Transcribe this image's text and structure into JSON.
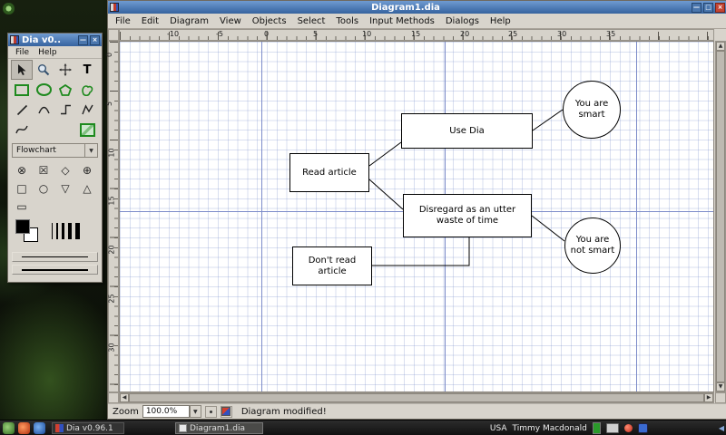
{
  "icons": {
    "close": "×",
    "minimize": "—",
    "maximize": "□",
    "dropdown": "▼",
    "arrow_left": "◀",
    "arrow_right": "▶",
    "arrow_up": "▲",
    "arrow_down": "▼",
    "panel_hide": "◀"
  },
  "main_window": {
    "title": "Diagram1.dia",
    "menus": [
      "File",
      "Edit",
      "Diagram",
      "View",
      "Objects",
      "Select",
      "Tools",
      "Input Methods",
      "Dialogs",
      "Help"
    ],
    "ruler_h_labels": [
      "-10",
      "-5",
      "0",
      "5",
      "10",
      "15",
      "20",
      "25",
      "30",
      "35"
    ],
    "ruler_v_labels": [
      "0",
      "5",
      "10",
      "15",
      "20",
      "25",
      "30"
    ],
    "statusbar": {
      "zoom_label": "Zoom",
      "zoom_value": "100.0%",
      "message": "Diagram modified!"
    }
  },
  "diagram": {
    "nodes": {
      "use_dia": "Use Dia",
      "read_article": "Read article",
      "disregard": "Disregard as an utter waste of time",
      "dont_read": "Don't read article",
      "smart": "You are smart",
      "not_smart": "You are not smart"
    }
  },
  "toolbox": {
    "title": "Dia v0..",
    "menus": [
      "File",
      "Help"
    ],
    "text_tool_glyph": "T",
    "category": "Flowchart",
    "shapes": [
      "⊗",
      "☒",
      "◇",
      "⊕",
      "□",
      "○",
      "▽",
      "△",
      "▭"
    ]
  },
  "taskbar": {
    "window1": "Dia v0.96.1",
    "window2": "Diagram1.dia",
    "tray_layout": "USA",
    "tray_user": "Timmy Macdonald"
  }
}
